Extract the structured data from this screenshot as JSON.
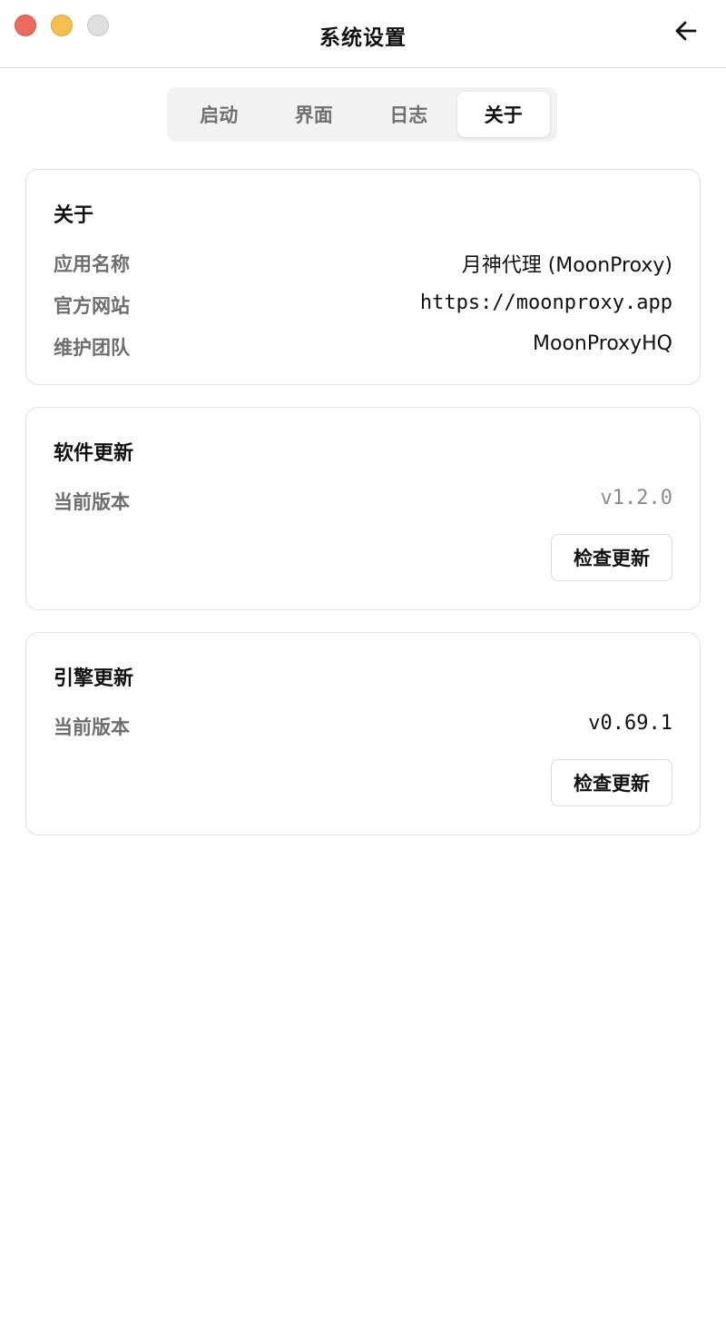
{
  "window": {
    "title": "系统设置"
  },
  "tabs": [
    {
      "label": "启动",
      "active": false
    },
    {
      "label": "界面",
      "active": false
    },
    {
      "label": "日志",
      "active": false
    },
    {
      "label": "关于",
      "active": true
    }
  ],
  "about": {
    "title": "关于",
    "rows": [
      {
        "label": "应用名称",
        "value": "月神代理 (MoonProxy)"
      },
      {
        "label": "官方网站",
        "value": "https://moonproxy.app"
      },
      {
        "label": "维护团队",
        "value": "MoonProxyHQ"
      }
    ]
  },
  "software_update": {
    "title": "软件更新",
    "version_label": "当前版本",
    "version_value": "v1.2.0",
    "check_button": "检查更新"
  },
  "engine_update": {
    "title": "引擎更新",
    "version_label": "当前版本",
    "version_value": "v0.69.1",
    "check_button": "检查更新"
  },
  "icons": {
    "back": "arrow-left-icon"
  },
  "colors": {
    "close": "#ec6a5e",
    "minimize": "#f4bf4f",
    "zoom": "#dedede"
  }
}
